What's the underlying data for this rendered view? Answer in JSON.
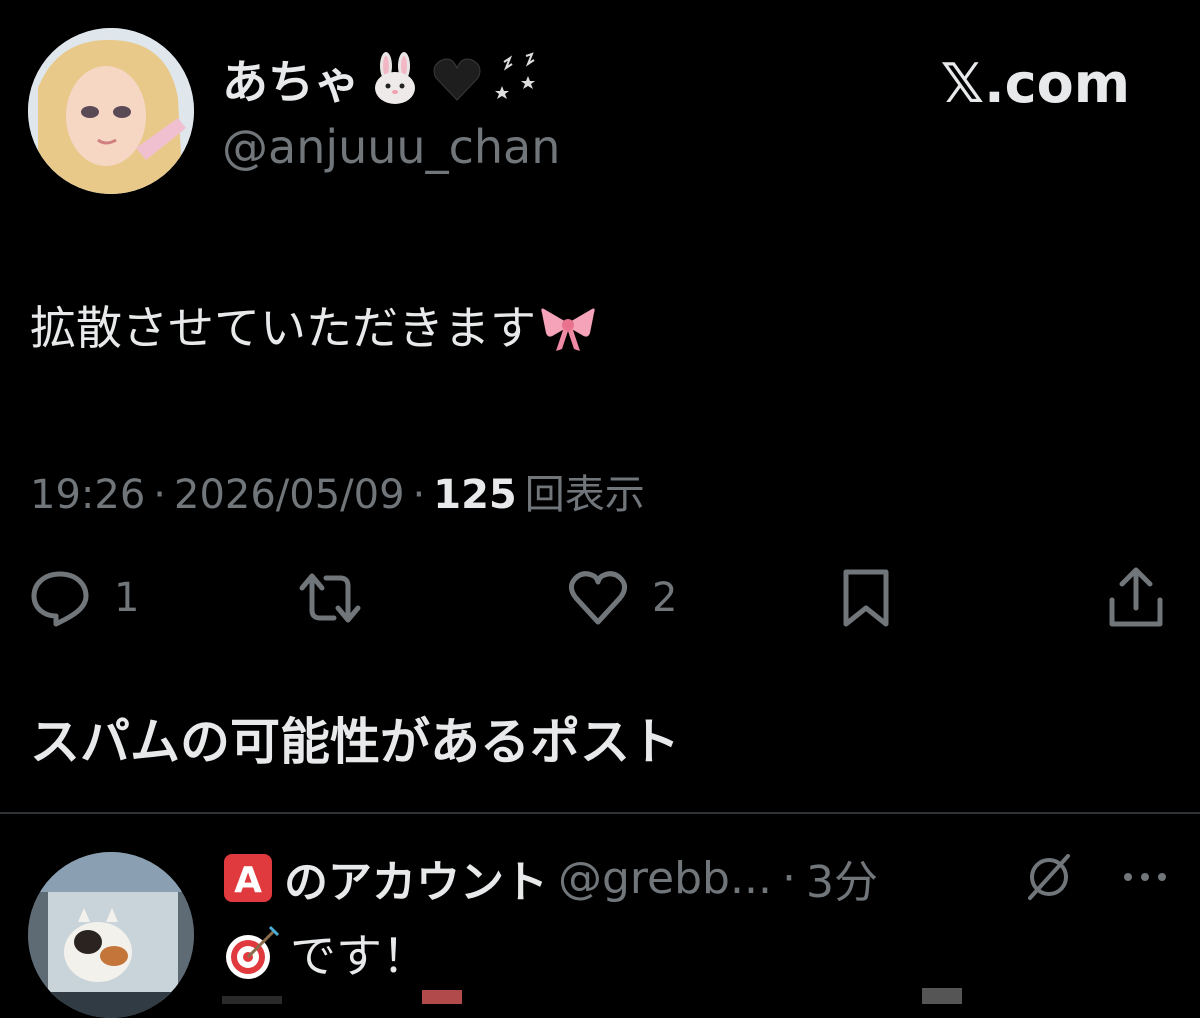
{
  "post": {
    "author": {
      "display_name": "あちゃ",
      "name_emojis": [
        "rabbit-face",
        "black-heart",
        "dizzy-sparkles"
      ],
      "handle": "@anjuuu_chan"
    },
    "brand": "𝕏.com",
    "text": "拡散させていただきます",
    "text_emoji": "pink-ribbon",
    "time": "19:26",
    "date": "2026/05/09",
    "views_count": "125",
    "views_label": "回表示",
    "separator": "·",
    "actions": {
      "reply_count": "1",
      "like_count": "2"
    }
  },
  "spam_section": {
    "heading": "スパムの可能性があるポスト"
  },
  "reply": {
    "badge": "A",
    "display_name": "のアカウント",
    "handle": "@grebb...",
    "separator": "·",
    "time": "3分",
    "text": "です！"
  },
  "colors": {
    "background": "#000000",
    "text_primary": "#e7e9ea",
    "text_secondary": "#71767b",
    "divider": "#2f3336",
    "badge_red": "#e0393e"
  }
}
